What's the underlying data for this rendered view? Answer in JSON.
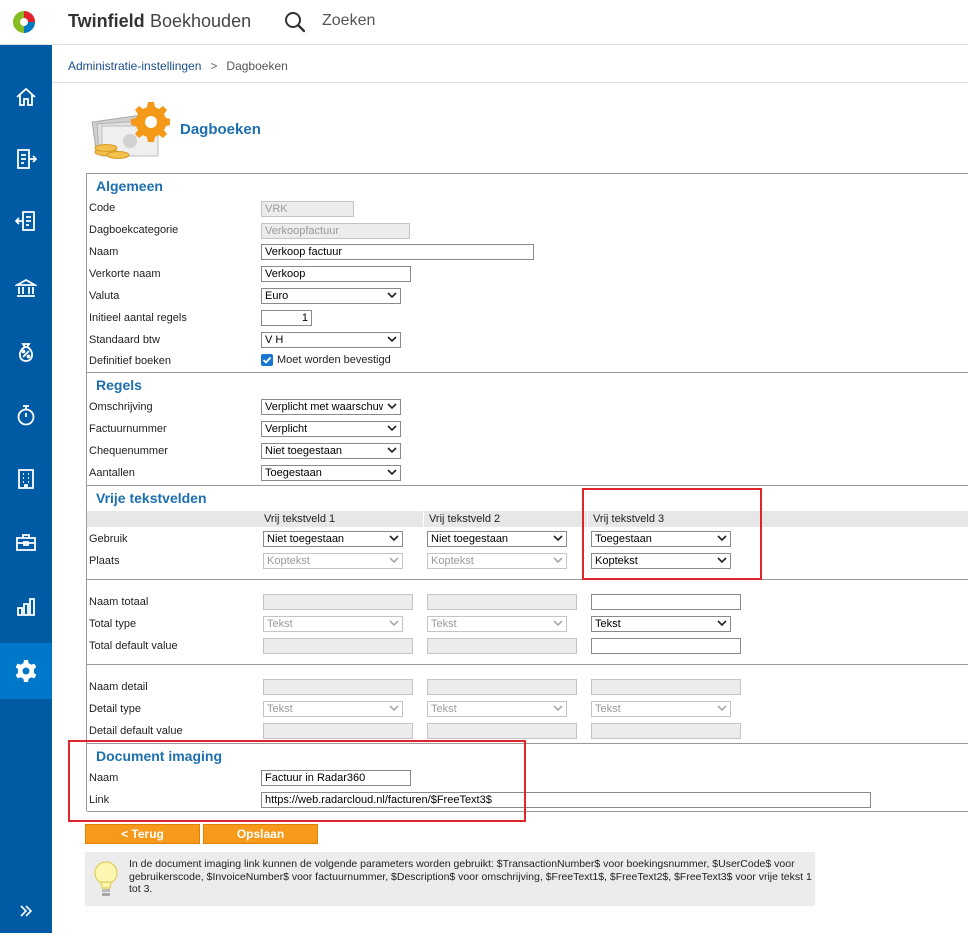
{
  "header": {
    "brand": "Twinfield",
    "product": "Boekhouden",
    "search_label": "Zoeken"
  },
  "sidebar": {
    "items": [
      {
        "icon": "home-icon"
      },
      {
        "icon": "document-in-icon"
      },
      {
        "icon": "document-out-icon"
      },
      {
        "icon": "bank-icon"
      },
      {
        "icon": "percent-bag-icon"
      },
      {
        "icon": "stopwatch-icon"
      },
      {
        "icon": "building-icon"
      },
      {
        "icon": "briefcase-icon"
      },
      {
        "icon": "bar-chart-icon"
      },
      {
        "icon": "gear-icon",
        "active": true
      }
    ],
    "expand_icon": "double-chevron-right-icon"
  },
  "breadcrumb": {
    "parent": "Administratie-instellingen",
    "current": "Dagboeken"
  },
  "page": {
    "title": "Dagboeken"
  },
  "general": {
    "title": "Algemeen",
    "code_label": "Code",
    "code_value": "VRK",
    "category_label": "Dagboekcategorie",
    "category_value": "Verkoopfactuur",
    "name_label": "Naam",
    "name_value": "Verkoop factuur",
    "short_name_label": "Verkorte naam",
    "short_name_value": "Verkoop",
    "currency_label": "Valuta",
    "currency_value": "Euro",
    "initial_lines_label": "Initieel aantal regels",
    "initial_lines_value": "1",
    "vat_label": "Standaard btw",
    "vat_value": "V H",
    "final_label": "Definitief boeken",
    "final_checkbox_label": "Moet worden bevestigd"
  },
  "rules": {
    "title": "Regels",
    "description_label": "Omschrijving",
    "description_value": "Verplicht met waarschuwing",
    "invoice_label": "Factuurnummer",
    "invoice_value": "Verplicht",
    "cheque_label": "Chequenummer",
    "cheque_value": "Niet toegestaan",
    "quantities_label": "Aantallen",
    "quantities_value": "Toegestaan"
  },
  "free_text": {
    "title": "Vrije tekstvelden",
    "col1": "Vrij tekstveld 1",
    "col2": "Vrij tekstveld 2",
    "col3": "Vrij tekstveld 3",
    "usage_label": "Gebruik",
    "usage1": "Niet toegestaan",
    "usage2": "Niet toegestaan",
    "usage3": "Toegestaan",
    "place_label": "Plaats",
    "place1": "Koptekst",
    "place2": "Koptekst",
    "place3": "Koptekst",
    "total_name_label": "Naam totaal",
    "total_type_label": "Total type",
    "total_type1": "Tekst",
    "total_type2": "Tekst",
    "total_type3": "Tekst",
    "total_default_label": "Total default value",
    "detail_name_label": "Naam detail",
    "detail_type_label": "Detail type",
    "detail_type1": "Tekst",
    "detail_type2": "Tekst",
    "detail_type3": "Tekst",
    "detail_default_label": "Detail default value"
  },
  "imaging": {
    "title": "Document imaging",
    "name_label": "Naam",
    "name_value": "Factuur in Radar360",
    "link_label": "Link",
    "link_value": "https://web.radarcloud.nl/facturen/$FreeText3$"
  },
  "buttons": {
    "back": "< Terug",
    "save": "Opslaan"
  },
  "info": {
    "text": "In de document imaging link kunnen de volgende parameters worden gebruikt: $TransactionNumber$ voor boekingsnummer, $UserCode$ voor gebruikerscode, $InvoiceNumber$ voor factuurnummer, $Description$ voor omschrijving, $FreeText1$, $FreeText2$, $FreeText3$ voor vrije tekst 1 tot 3."
  },
  "colors": {
    "sidebar": "#005aa4",
    "sidebar_active": "#0077c8",
    "accent_blue": "#1d6fb0",
    "button_orange": "#f79a1b",
    "highlight_red": "#e0252b"
  }
}
